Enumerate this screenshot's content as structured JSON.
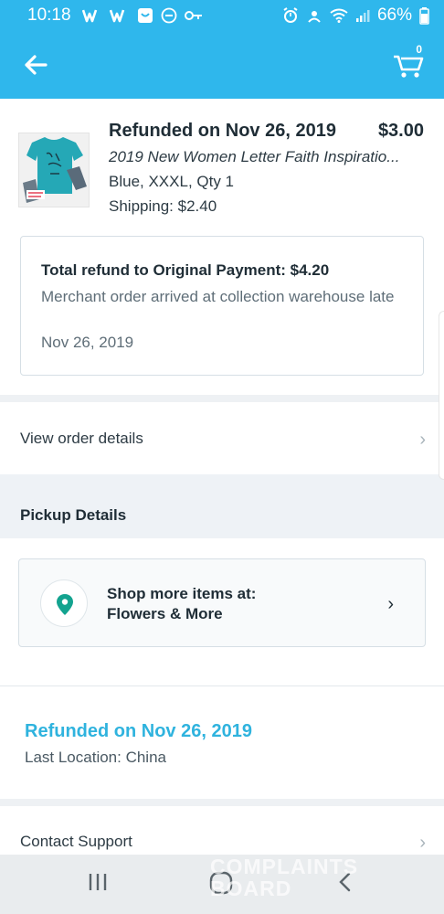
{
  "status_bar": {
    "time": "10:18",
    "battery": "66%"
  },
  "header": {
    "cart_count": "0",
    "accent_color": "#2fb7ec"
  },
  "product": {
    "status": "Refunded on Nov 26, 2019",
    "price": "$3.00",
    "name": "2019 New Women Letter Faith Inspiratio...",
    "variant": "Blue, XXXL, Qty 1",
    "shipping": "Shipping: $2.40"
  },
  "refund": {
    "title": "Total refund to Original Payment: $4.20",
    "reason": "Merchant order arrived at collection warehouse late",
    "date": "Nov 26, 2019"
  },
  "order_details_link": "View order details",
  "pickup": {
    "header": "Pickup Details",
    "shop_line1": "Shop more items at:",
    "shop_line2": "Flowers & More"
  },
  "tracking": {
    "status": "Refunded on Nov 26, 2019",
    "location": "Last Location: China",
    "status_color": "#2fb3de"
  },
  "contact_support": "Contact Support",
  "watermark": {
    "line1": "COMPLAINTS",
    "line2": "BOARD"
  }
}
